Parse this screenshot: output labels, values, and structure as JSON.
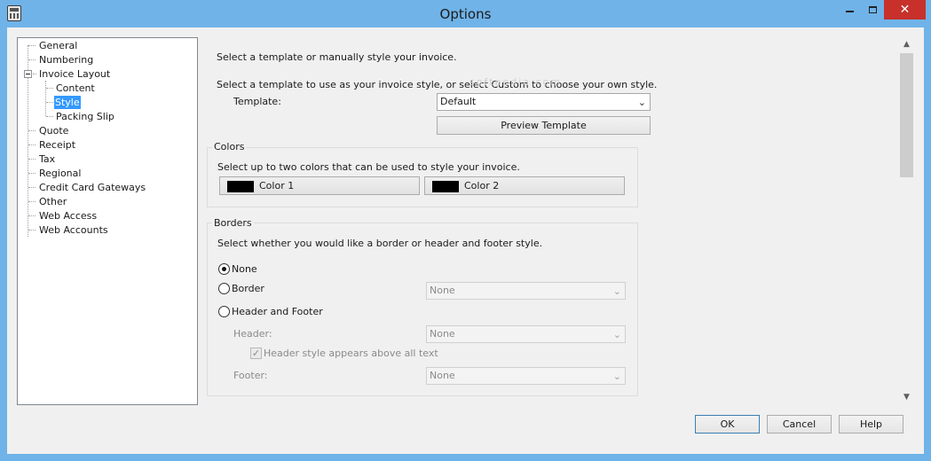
{
  "window": {
    "title": "Options",
    "close_glyph": "✕"
  },
  "tree": {
    "items": [
      {
        "label": "General"
      },
      {
        "label": "Numbering"
      },
      {
        "label": "Invoice Layout"
      },
      {
        "label": "Content"
      },
      {
        "label": "Style"
      },
      {
        "label": "Packing Slip"
      },
      {
        "label": "Quote"
      },
      {
        "label": "Receipt"
      },
      {
        "label": "Tax"
      },
      {
        "label": "Regional"
      },
      {
        "label": "Credit Card Gateways"
      },
      {
        "label": "Other"
      },
      {
        "label": "Web Access"
      },
      {
        "label": "Web Accounts"
      }
    ],
    "selected": "Style"
  },
  "style_panel": {
    "intro": "Select a template or manually style your invoice.",
    "template_instructions": "Select a template to use as your invoice style, or select Custom to choose your own style.",
    "template_label": "Template:",
    "template_value": "Default",
    "preview_button": "Preview Template",
    "colors": {
      "group_label": "Colors",
      "instructions": "Select up to two colors that can be used to style your invoice.",
      "color1_label": "Color 1",
      "color1_hex": "#000000",
      "color2_label": "Color 2",
      "color2_hex": "#000000"
    },
    "borders": {
      "group_label": "Borders",
      "instructions": "Select whether you would like a border or header and footer style.",
      "options": [
        {
          "label": "None",
          "checked": true
        },
        {
          "label": "Border",
          "checked": false
        },
        {
          "label": "Header and Footer",
          "checked": false
        }
      ],
      "border_select_value": "None",
      "header_label": "Header:",
      "header_value": "None",
      "header_above_label": "Header style appears above all text",
      "header_above_checked": true,
      "footer_label": "Footer:",
      "footer_value": "None"
    }
  },
  "watermark": "softpedia.com",
  "footer_buttons": {
    "ok": "OK",
    "cancel": "Cancel",
    "help": "Help"
  },
  "colors": {
    "titlebar": "#6fb3e8",
    "close": "#c7302b",
    "selection": "#3399ff"
  }
}
